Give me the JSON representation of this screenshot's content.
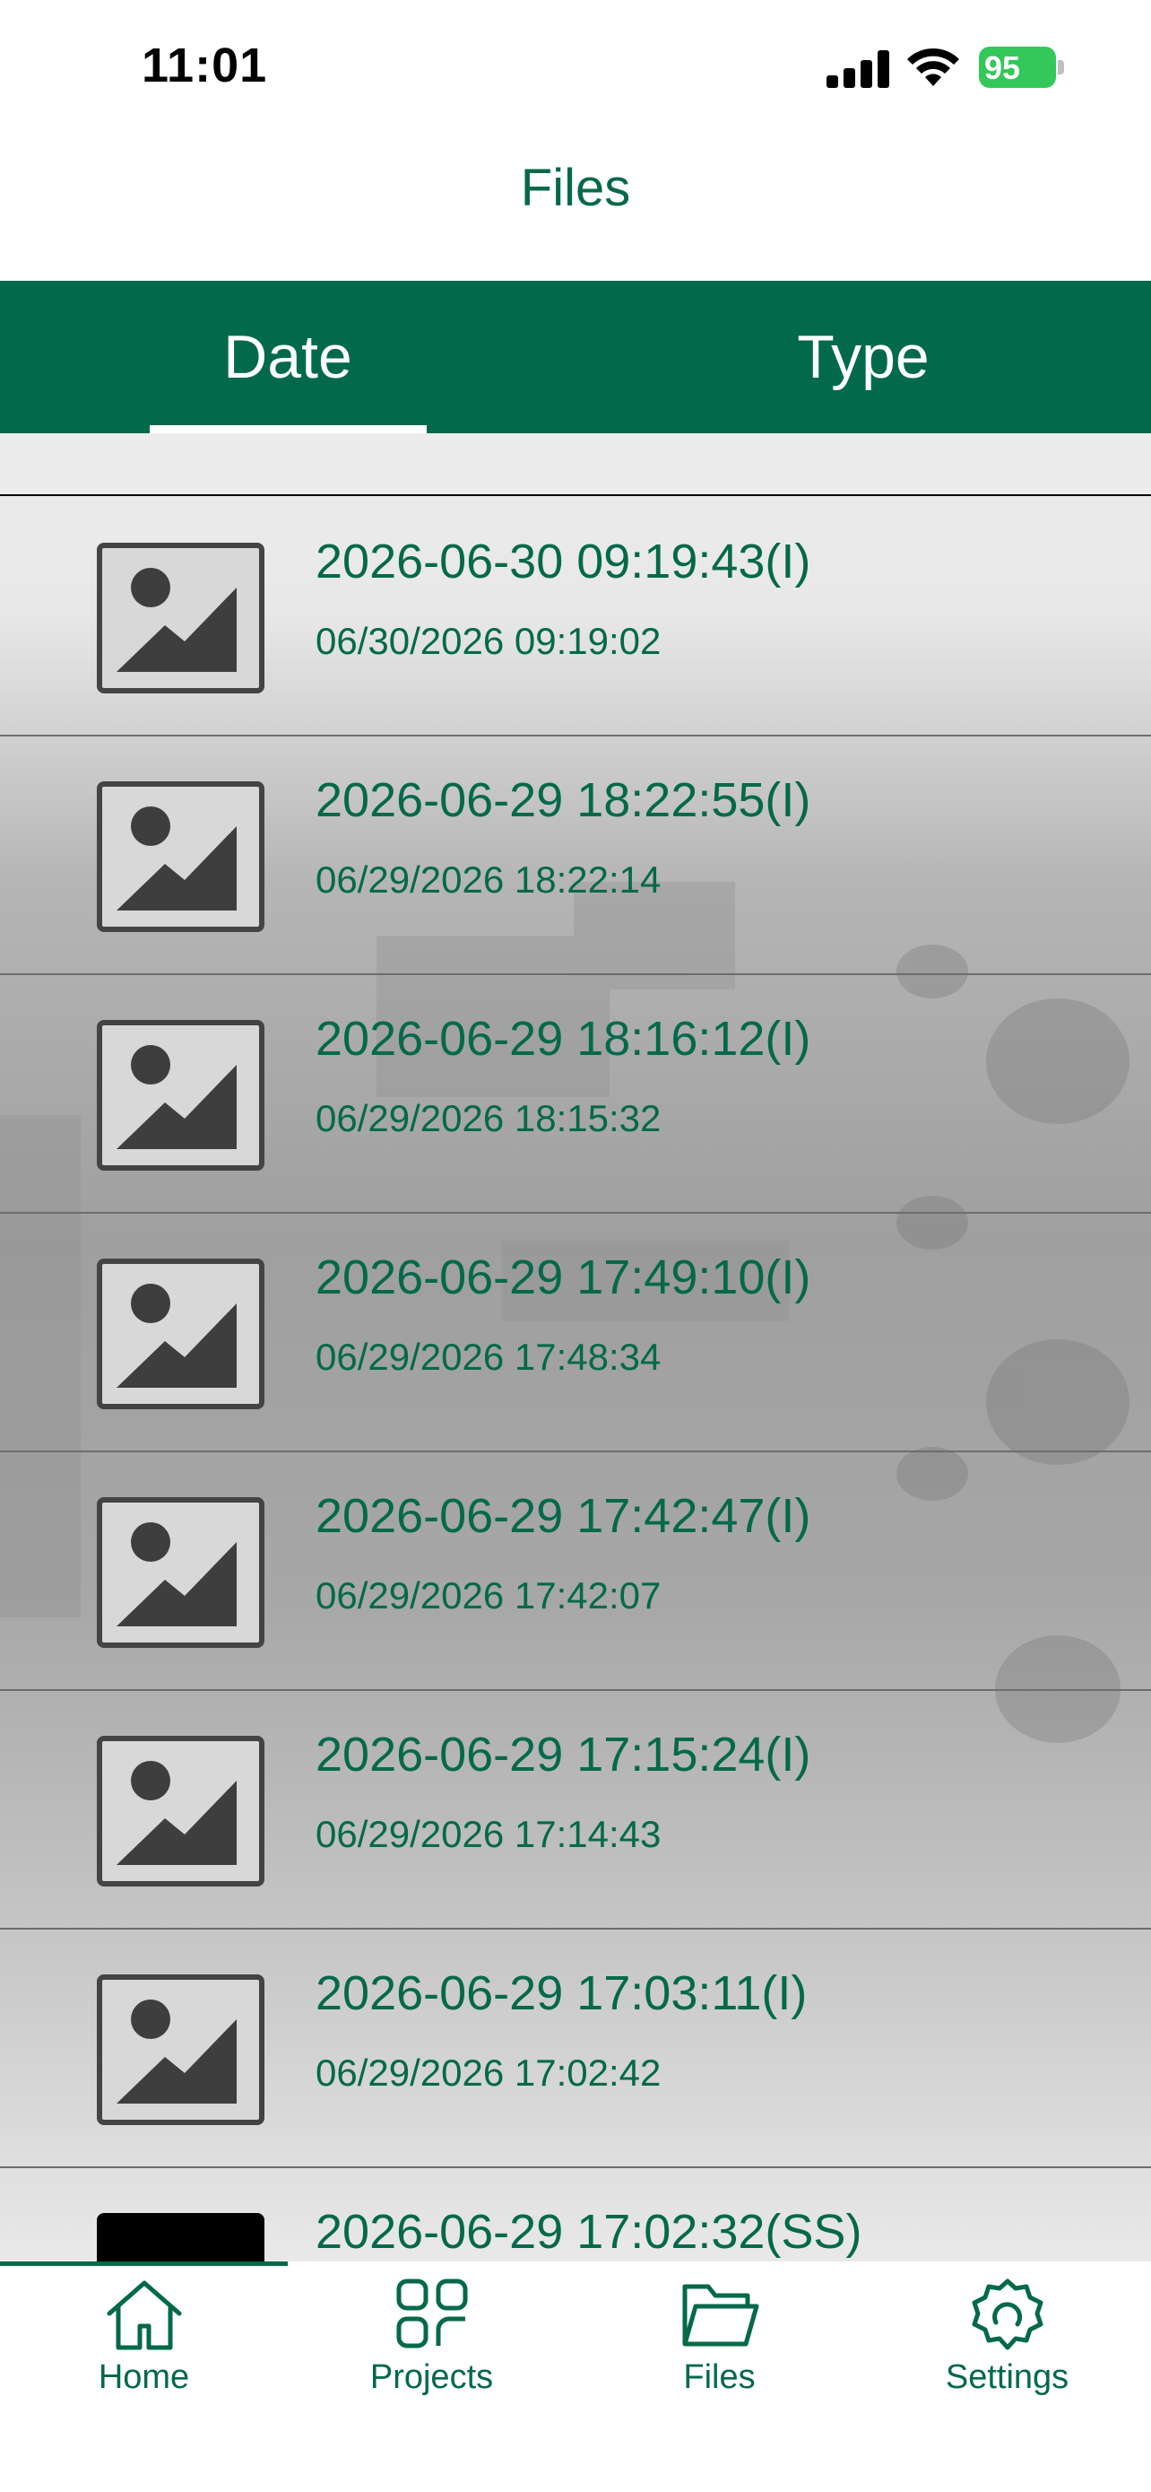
{
  "status_bar": {
    "time": "11:01",
    "battery_percent": "95"
  },
  "header": {
    "title": "Files"
  },
  "tabs": [
    {
      "label": "Date",
      "active": true
    },
    {
      "label": "Type",
      "active": false
    }
  ],
  "files": [
    {
      "title": "2026-06-30 09:19:43(I)",
      "subtitle": "06/30/2026 09:19:02",
      "thumbnail": "image-placeholder-icon"
    },
    {
      "title": "2026-06-29 18:22:55(I)",
      "subtitle": "06/29/2026 18:22:14",
      "thumbnail": "image-placeholder-icon"
    },
    {
      "title": "2026-06-29 18:16:12(I)",
      "subtitle": "06/29/2026 18:15:32",
      "thumbnail": "image-placeholder-icon"
    },
    {
      "title": "2026-06-29 17:49:10(I)",
      "subtitle": "06/29/2026 17:48:34",
      "thumbnail": "image-placeholder-icon"
    },
    {
      "title": "2026-06-29 17:42:47(I)",
      "subtitle": "06/29/2026 17:42:07",
      "thumbnail": "image-placeholder-icon"
    },
    {
      "title": "2026-06-29 17:15:24(I)",
      "subtitle": "06/29/2026 17:14:43",
      "thumbnail": "image-placeholder-icon"
    },
    {
      "title": "2026-06-29 17:03:11(I)",
      "subtitle": "06/29/2026 17:02:42",
      "thumbnail": "image-placeholder-icon"
    },
    {
      "title": "2026-06-29 17:02:32(SS)",
      "subtitle": "",
      "thumbnail": "screenshot-thumbnail"
    }
  ],
  "bottom_nav": [
    {
      "label": "Home",
      "icon": "home-icon",
      "active": true
    },
    {
      "label": "Projects",
      "icon": "grid-icon",
      "active": false
    },
    {
      "label": "Files",
      "icon": "folder-icon",
      "active": false
    },
    {
      "label": "Settings",
      "icon": "gear-icon",
      "active": false
    }
  ],
  "colors": {
    "brand_green": "#026a4b",
    "text_green": "#03694a",
    "battery_green": "#34c759"
  }
}
